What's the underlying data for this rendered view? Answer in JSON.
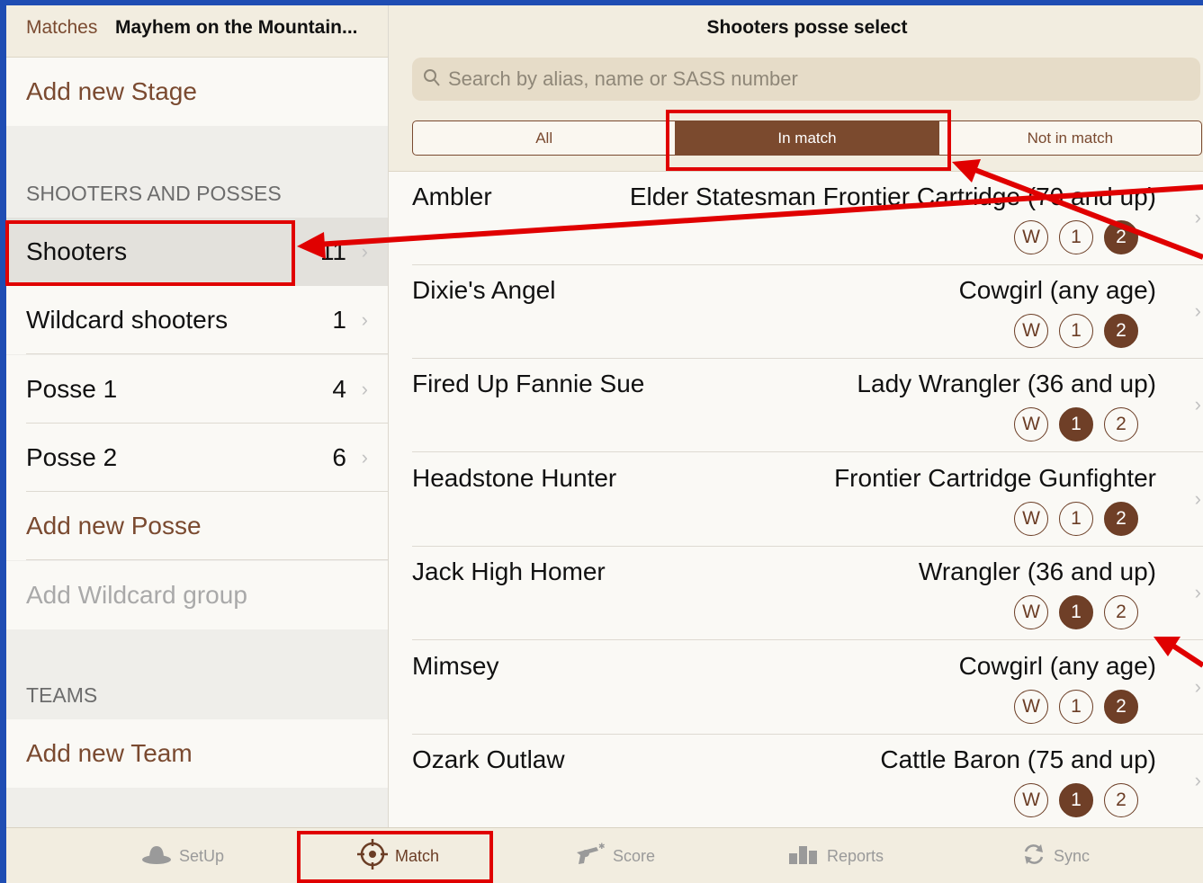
{
  "nav": {
    "back": "Matches",
    "match_title": "Mayhem on the Mountain..."
  },
  "left": {
    "add_stage": "Add new Stage",
    "section_shooters": "SHOOTERS AND POSSES",
    "rows": [
      {
        "label": "Shooters",
        "count": "11"
      },
      {
        "label": "Wildcard shooters",
        "count": "1"
      },
      {
        "label": "Posse 1",
        "count": "4"
      },
      {
        "label": "Posse 2",
        "count": "6"
      }
    ],
    "add_posse": "Add new Posse",
    "add_wildcard": "Add Wildcard group",
    "section_teams": "TEAMS",
    "add_team": "Add new Team"
  },
  "right": {
    "title": "Shooters posse select",
    "search_placeholder": "Search by alias, name or SASS number",
    "segments": [
      "All",
      "In match",
      "Not in match"
    ],
    "selected_segment": "In match",
    "shooters": [
      {
        "alias": "Ambler",
        "category": "Elder Statesman Frontier Cartridge (70 and up)",
        "w": "W",
        "p1": "1",
        "p2": "2",
        "selected": "2"
      },
      {
        "alias": "Dixie's Angel",
        "category": "Cowgirl (any age)",
        "w": "W",
        "p1": "1",
        "p2": "2",
        "selected": "2"
      },
      {
        "alias": "Fired Up Fannie Sue",
        "category": "Lady Wrangler (36 and up)",
        "w": "W",
        "p1": "1",
        "p2": "2",
        "selected": "1"
      },
      {
        "alias": "Headstone Hunter",
        "category": "Frontier Cartridge Gunfighter",
        "w": "W",
        "p1": "1",
        "p2": "2",
        "selected": "2"
      },
      {
        "alias": "Jack High Homer",
        "category": "Wrangler (36 and up)",
        "w": "W",
        "p1": "1",
        "p2": "2",
        "selected": "1"
      },
      {
        "alias": "Mimsey",
        "category": "Cowgirl (any age)",
        "w": "W",
        "p1": "1",
        "p2": "2",
        "selected": "2"
      },
      {
        "alias": "Ozark Outlaw",
        "category": "Cattle Baron (75 and up)",
        "w": "W",
        "p1": "1",
        "p2": "2",
        "selected": "1"
      }
    ]
  },
  "tabs": [
    {
      "label": "SetUp",
      "icon": "hat-icon"
    },
    {
      "label": "Match",
      "icon": "crosshair-icon"
    },
    {
      "label": "Score",
      "icon": "revolver-icon"
    },
    {
      "label": "Reports",
      "icon": "chart-icon"
    },
    {
      "label": "Sync",
      "icon": "sync-icon"
    }
  ],
  "active_tab": "Match",
  "colors": {
    "accent": "#7b4a2e",
    "highlight": "#e00000",
    "background": "#1f4db3"
  }
}
